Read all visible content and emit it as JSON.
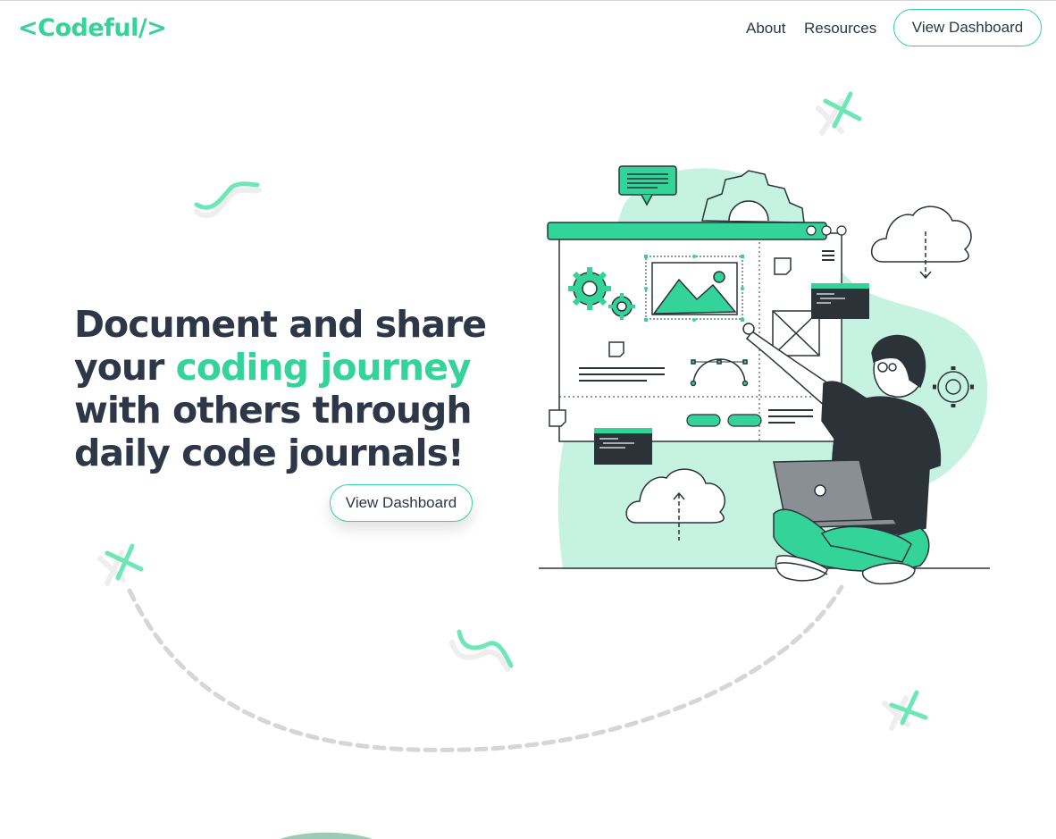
{
  "brand": {
    "logo_text": "<Codeful/>"
  },
  "nav": {
    "about": "About",
    "resources": "Resources",
    "dashboard_button": "View Dashboard"
  },
  "hero": {
    "headline_part1": "Document and share your ",
    "headline_accent": "coding journey",
    "headline_part2": " with others through daily code journals!",
    "cta_button": "View Dashboard"
  },
  "colors": {
    "accent": "#34d399",
    "text": "#2d3748",
    "blob": "#c6f2e2",
    "dark": "#2b3338"
  },
  "illustration": {
    "description_icons": [
      "gear-icon",
      "image-icon",
      "cloud-download-icon",
      "cloud-upload-icon",
      "code-window-icon",
      "chat-bubble-icon"
    ]
  }
}
